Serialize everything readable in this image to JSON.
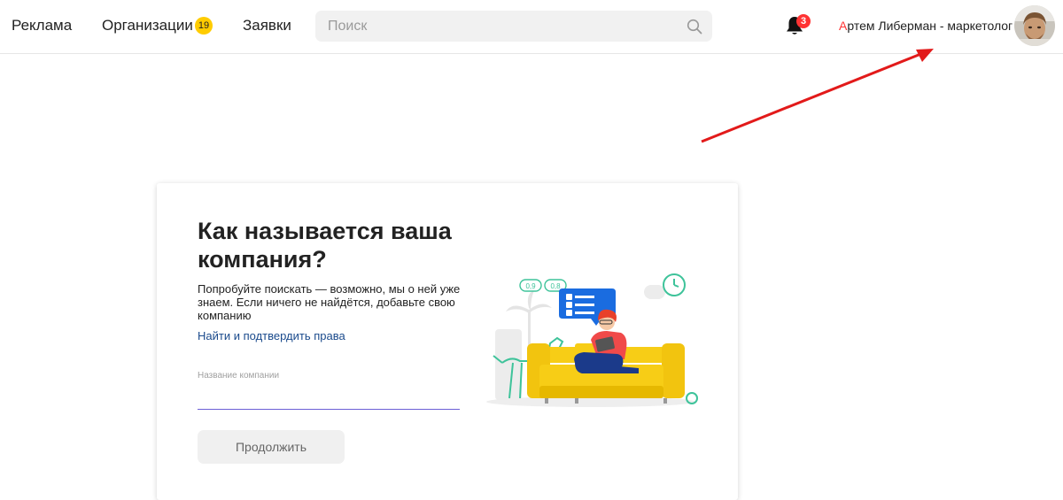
{
  "header": {
    "nav": [
      {
        "label": "Реклама"
      },
      {
        "label": "Организации",
        "badge": "19"
      },
      {
        "label": "Заявки"
      }
    ],
    "search": {
      "placeholder": "Поиск",
      "value": ""
    },
    "notifications_count": "3",
    "user": {
      "first_letter": "А",
      "rest_name": "ртем Либерман - маркетолог"
    }
  },
  "card": {
    "title": "Как называется ваша компания?",
    "description": "Попробуйте поискать — возможно, мы о ней уже знаем. Если ничего не найдётся, добавьте свою компанию",
    "link": "Найти и подтвердить права",
    "field_label": "Название компании",
    "field_value": "",
    "continue_label": "Продолжить",
    "illustration": {
      "rating_1": "0,9",
      "rating_2": "0,8"
    }
  },
  "colors": {
    "accent_red": "#ff3333",
    "badge_yellow": "#ffcc00",
    "link_blue": "#1a4a8c",
    "sofa_yellow": "#f7cd16",
    "illustration_green": "#3ec39a"
  }
}
